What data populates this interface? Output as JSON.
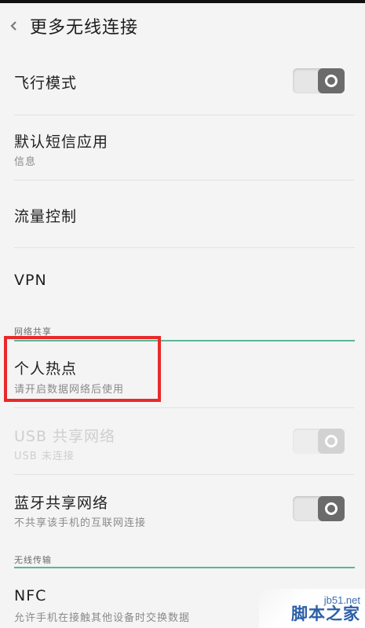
{
  "header": {
    "title": "更多无线连接",
    "back_icon": "chevron-left-icon"
  },
  "rows": {
    "airplane": {
      "title": "飞行模式",
      "toggle_on": false
    },
    "default_sms": {
      "title": "默认短信应用",
      "subtitle": "信息"
    },
    "traffic": {
      "title": "流量控制"
    },
    "vpn": {
      "title": "VPN"
    },
    "hotspot": {
      "title": "个人热点",
      "subtitle": "请开启数据网络后使用"
    },
    "usb_tether": {
      "title": "USB 共享网络",
      "subtitle": "USB 未连接",
      "toggle_on": false,
      "disabled": true
    },
    "bt_tether": {
      "title": "蓝牙共享网络",
      "subtitle": "不共享该手机的互联网连接",
      "toggle_on": false
    },
    "nfc": {
      "title": "NFC",
      "subtitle": "允许手机在接触其他设备时交换数据"
    }
  },
  "sections": {
    "tethering": "网络共享",
    "wireless_transfer": "无线传输"
  },
  "colors": {
    "section_line": "#5fb596",
    "highlight": "#e8292a",
    "toggle_knob": "#6b6b6b"
  },
  "watermark": {
    "url": "jb51.net",
    "name": "脚本之家"
  }
}
